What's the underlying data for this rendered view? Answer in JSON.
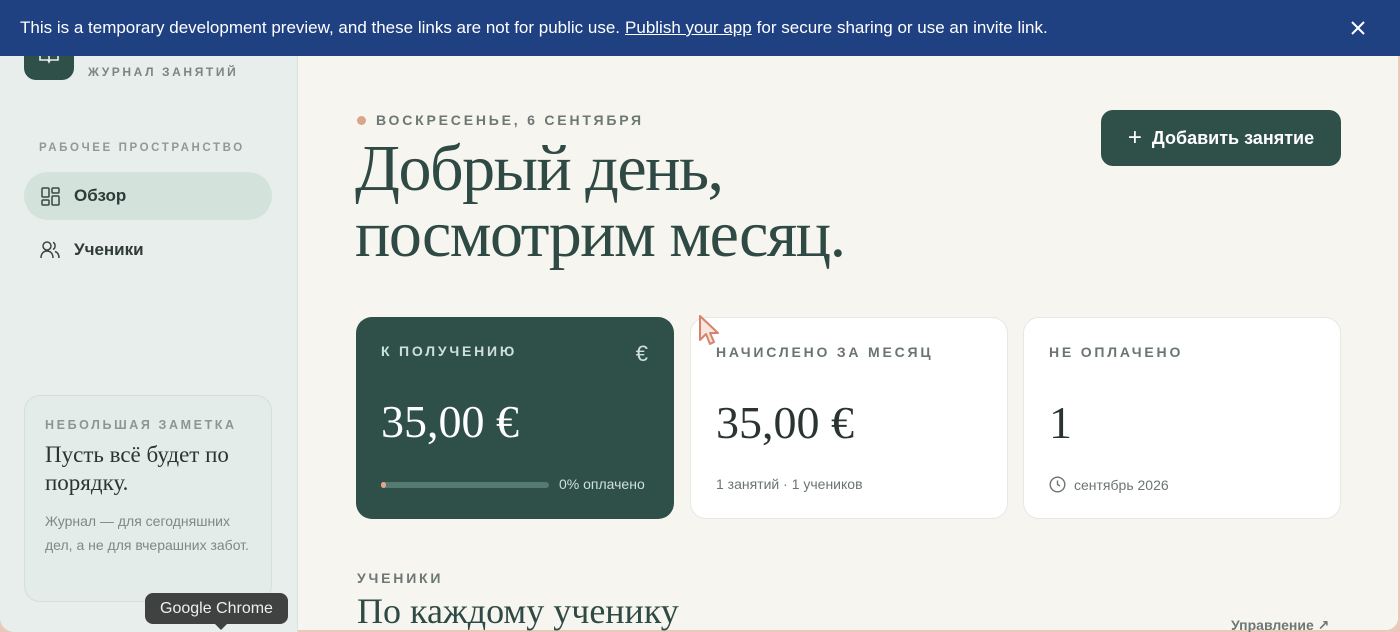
{
  "banner": {
    "text_before": "This is a temporary development preview, and these links are not for public use.",
    "link_label": "Publish your app",
    "text_after": "for secure sharing or use an invite link."
  },
  "sidebar": {
    "app_subtitle": "ЖУРНАЛ ЗАНЯТИЙ",
    "workspace_label": "РАБОЧЕЕ ПРОСТРАНСТВО",
    "items": [
      {
        "label": "Обзор",
        "icon": "grid-icon",
        "active": true
      },
      {
        "label": "Ученики",
        "icon": "users-icon",
        "active": false
      }
    ],
    "note": {
      "label": "НЕБОЛЬШАЯ ЗАМЕТКА",
      "title": "Пусть всё будет по порядку.",
      "body": "Журнал — для сегодняшних дел, а не для вчерашних забот."
    }
  },
  "tooltip": "Google Chrome",
  "header": {
    "date": "ВОСКРЕСЕНЬЕ, 6 СЕНТЯБРЯ",
    "greeting_line1": "Добрый день,",
    "greeting_line2": "посмотрим месяц.",
    "add_button": "Добавить занятие"
  },
  "cards": {
    "receivable": {
      "label": "К ПОЛУЧЕНИЮ",
      "value": "35,00 €",
      "progress_text": "0% оплачено",
      "progress_fraction": 0.0
    },
    "accrued": {
      "label": "НАЧИСЛЕНО ЗА МЕСЯЦ",
      "value": "35,00 €",
      "footer": "1 занятий · 1 учеников"
    },
    "unpaid": {
      "label": "НЕ ОПЛАЧЕНО",
      "value": "1",
      "footer": "сентябрь 2026"
    }
  },
  "students_section": {
    "label": "УЧЕНИКИ",
    "title": "По каждому ученику",
    "manage_link": "Управление ↗"
  },
  "colors": {
    "accent_dark": "#2f4f49",
    "banner": "#1f4182",
    "dot": "#d9a58b"
  }
}
